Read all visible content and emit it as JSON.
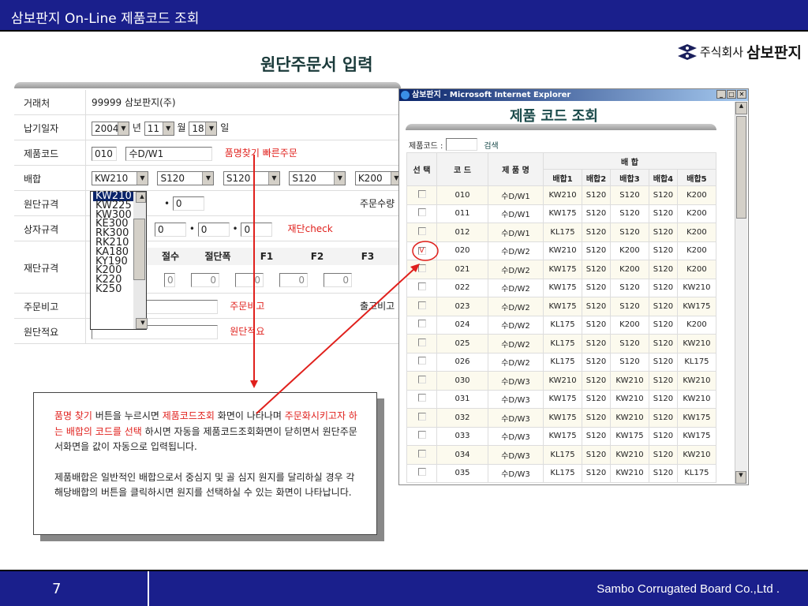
{
  "header": {
    "title": "삼보판지 On-Line 제품코드 조회",
    "logo_prefix": "주식회사",
    "logo_name": "삼보판지",
    "page_title": "원단주문서 입력"
  },
  "form": {
    "rows": [
      {
        "label": "거래처"
      },
      {
        "label": "납기일자"
      },
      {
        "label": "제품코드"
      },
      {
        "label": "배합"
      },
      {
        "label": "원단규격"
      },
      {
        "label": "상자규격"
      },
      {
        "label": "재단규격"
      },
      {
        "label": "주문비고"
      },
      {
        "label": "원단적요"
      }
    ],
    "customer": "99999  삼보판지(주)",
    "year": "2004",
    "year_unit": "년",
    "month": "11",
    "month_unit": "월",
    "day": "18",
    "day_unit": "일",
    "product_code": "010",
    "product_name": "수D/W1",
    "find_link": "품명찾기",
    "quick_order": "빠른주문",
    "mix": [
      "KW210",
      "S120",
      "S120",
      "S120",
      "K200"
    ],
    "dropdown_options": [
      "KW210",
      "KW225",
      "KW300",
      "KE300",
      "RK300",
      "RK210",
      "KA180",
      "KY190",
      "K200",
      "K220",
      "K250"
    ],
    "fabric_w": "0",
    "order_qty_label": "주문수량",
    "box": [
      "0",
      "0",
      "0"
    ],
    "cut_check": "재단check",
    "cut_headers": [
      "절수",
      "절단폭",
      "F1",
      "F2",
      "F3"
    ],
    "cut_values": [
      "0",
      "0",
      "0",
      "0",
      "0"
    ],
    "order_note_link": "주문비고",
    "ship_note_label": "출고비고",
    "fabric_note_link": "원단적요"
  },
  "popup": {
    "title": "삼보판지 - Microsoft Internet Explorer",
    "heading": "제품 코드 조회",
    "search_label": "제품코드 :",
    "search_value": "",
    "search_button": "검색",
    "headers": {
      "select": "선 택",
      "code": "코 드",
      "name": "제 품 명",
      "mix": "배 합",
      "mix_cols": [
        "배합1",
        "배합2",
        "배합3",
        "배합4",
        "배합5"
      ]
    },
    "rows": [
      {
        "checked": false,
        "code": "010",
        "name": "수D/W1",
        "m": [
          "KW210",
          "S120",
          "S120",
          "S120",
          "K200"
        ]
      },
      {
        "checked": false,
        "code": "011",
        "name": "수D/W1",
        "m": [
          "KW175",
          "S120",
          "S120",
          "S120",
          "K200"
        ]
      },
      {
        "checked": false,
        "code": "012",
        "name": "수D/W1",
        "m": [
          "KL175",
          "S120",
          "S120",
          "S120",
          "K200"
        ]
      },
      {
        "checked": true,
        "code": "020",
        "name": "수D/W2",
        "m": [
          "KW210",
          "S120",
          "K200",
          "S120",
          "K200"
        ]
      },
      {
        "checked": false,
        "code": "021",
        "name": "수D/W2",
        "m": [
          "KW175",
          "S120",
          "K200",
          "S120",
          "K200"
        ]
      },
      {
        "checked": false,
        "code": "022",
        "name": "수D/W2",
        "m": [
          "KW175",
          "S120",
          "S120",
          "S120",
          "KW210"
        ]
      },
      {
        "checked": false,
        "code": "023",
        "name": "수D/W2",
        "m": [
          "KW175",
          "S120",
          "S120",
          "S120",
          "KW175"
        ]
      },
      {
        "checked": false,
        "code": "024",
        "name": "수D/W2",
        "m": [
          "KL175",
          "S120",
          "K200",
          "S120",
          "K200"
        ]
      },
      {
        "checked": false,
        "code": "025",
        "name": "수D/W2",
        "m": [
          "KL175",
          "S120",
          "S120",
          "S120",
          "KW210"
        ]
      },
      {
        "checked": false,
        "code": "026",
        "name": "수D/W2",
        "m": [
          "KL175",
          "S120",
          "S120",
          "S120",
          "KL175"
        ]
      },
      {
        "checked": false,
        "code": "030",
        "name": "수D/W3",
        "m": [
          "KW210",
          "S120",
          "KW210",
          "S120",
          "KW210"
        ]
      },
      {
        "checked": false,
        "code": "031",
        "name": "수D/W3",
        "m": [
          "KW175",
          "S120",
          "KW210",
          "S120",
          "KW210"
        ]
      },
      {
        "checked": false,
        "code": "032",
        "name": "수D/W3",
        "m": [
          "KW175",
          "S120",
          "KW210",
          "S120",
          "KW175"
        ]
      },
      {
        "checked": false,
        "code": "033",
        "name": "수D/W3",
        "m": [
          "KW175",
          "S120",
          "KW175",
          "S120",
          "KW175"
        ]
      },
      {
        "checked": false,
        "code": "034",
        "name": "수D/W3",
        "m": [
          "KL175",
          "S120",
          "KW210",
          "S120",
          "KW210"
        ]
      },
      {
        "checked": false,
        "code": "035",
        "name": "수D/W3",
        "m": [
          "KL175",
          "S120",
          "KW210",
          "S120",
          "KL175"
        ]
      }
    ]
  },
  "callout": {
    "p1": [
      {
        "t": "품명 찾기",
        "red": true
      },
      {
        "t": " 버튼을 누르시면 ",
        "red": false
      },
      {
        "t": "제품코드조회",
        "red": true
      },
      {
        "t": " 화면이 나타나며  ",
        "red": false
      },
      {
        "t": "주문화시키고자 하는 배합의 코드를 선택",
        "red": true
      },
      {
        "t": " 하시면 자동을 제품코드조회화면이 닫히면서 원단주문서화면을 값이 자동으로 입력됩니다.",
        "red": false
      }
    ],
    "p2": "제품배합은 일반적인 배합으로서 중심지 및 골 심지 원지를 달리하실 경우 각 해당배합의 버튼을 클릭하시면 원지를 선택하실 수 있는 화면이 나타납니다."
  },
  "footer": {
    "page": "7",
    "company": "Sambo Corrugated Board Co.,Ltd ."
  }
}
